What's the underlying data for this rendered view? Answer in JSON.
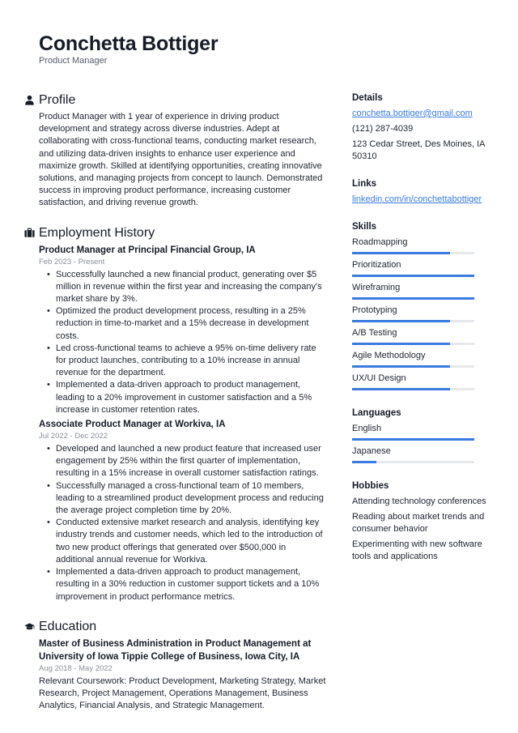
{
  "header": {
    "name": "Conchetta Bottiger",
    "title": "Product Manager"
  },
  "profile": {
    "heading": "Profile",
    "icon": "person-icon",
    "text": "Product Manager with 1 year of experience in driving product development and strategy across diverse industries. Adept at collaborating with cross-functional teams, conducting market research, and utilizing data-driven insights to enhance user experience and maximize growth. Skilled at identifying opportunities, creating innovative solutions, and managing projects from concept to launch. Demonstrated success in improving product performance, increasing customer satisfaction, and driving revenue growth."
  },
  "employment": {
    "heading": "Employment History",
    "icon": "briefcase-icon",
    "jobs": [
      {
        "title": "Product Manager at Principal Financial Group, IA",
        "dates": "Feb 2023 - Present",
        "bullets": [
          "Successfully launched a new financial product, generating over $5 million in revenue within the first year and increasing the company's market share by 3%.",
          "Optimized the product development process, resulting in a 25% reduction in time-to-market and a 15% decrease in development costs.",
          "Led cross-functional teams to achieve a 95% on-time delivery rate for product launches, contributing to a 10% increase in annual revenue for the department.",
          "Implemented a data-driven approach to product management, leading to a 20% improvement in customer satisfaction and a 5% increase in customer retention rates."
        ]
      },
      {
        "title": "Associate Product Manager at Workiva, IA",
        "dates": "Jul 2022 - Dec 2022",
        "bullets": [
          "Developed and launched a new product feature that increased user engagement by 25% within the first quarter of implementation, resulting in a 15% increase in overall customer satisfaction ratings.",
          "Successfully managed a cross-functional team of 10 members, leading to a streamlined product development process and reducing the average project completion time by 20%.",
          "Conducted extensive market research and analysis, identifying key industry trends and customer needs, which led to the introduction of two new product offerings that generated over $500,000 in additional annual revenue for Workiva.",
          "Implemented a data-driven approach to product management, resulting in a 30% reduction in customer support tickets and a 10% improvement in product performance metrics."
        ]
      }
    ]
  },
  "education": {
    "heading": "Education",
    "icon": "graduation-cap-icon",
    "entries": [
      {
        "title": "Master of Business Administration in Product Management at University of Iowa Tippie College of Business, Iowa City, IA",
        "dates": "Aug 2018 - May 2022",
        "text": "Relevant Coursework: Product Development, Marketing Strategy, Market Research, Project Management, Operations Management, Business Analytics, Financial Analysis, and Strategic Management."
      }
    ]
  },
  "details": {
    "heading": "Details",
    "email": "conchetta.bottiger@gmail.com",
    "phone": "(121) 287-4039",
    "address": "123 Cedar Street, Des Moines, IA 50310"
  },
  "links": {
    "heading": "Links",
    "items": [
      "linkedin.com/in/conchettabottiger"
    ]
  },
  "skills": {
    "heading": "Skills",
    "items": [
      {
        "name": "Roadmapping",
        "level": 0.8
      },
      {
        "name": "Prioritization",
        "level": 1.0
      },
      {
        "name": "Wireframing",
        "level": 1.0
      },
      {
        "name": "Prototyping",
        "level": 0.8
      },
      {
        "name": "A/B Testing",
        "level": 0.8
      },
      {
        "name": "Agile Methodology",
        "level": 0.8
      },
      {
        "name": "UX/UI Design",
        "level": 0.8
      }
    ]
  },
  "languages": {
    "heading": "Languages",
    "items": [
      {
        "name": "English",
        "level": 1.0
      },
      {
        "name": "Japanese",
        "level": 0.2
      }
    ]
  },
  "hobbies": {
    "heading": "Hobbies",
    "items": [
      "Attending technology conferences",
      "Reading about market trends and consumer behavior",
      "Experimenting with new software tools and applications"
    ]
  },
  "colors": {
    "accent": "#3b7be0",
    "track": "#e6e8eb",
    "text": "#1f2430",
    "muted": "#8a8f98"
  }
}
